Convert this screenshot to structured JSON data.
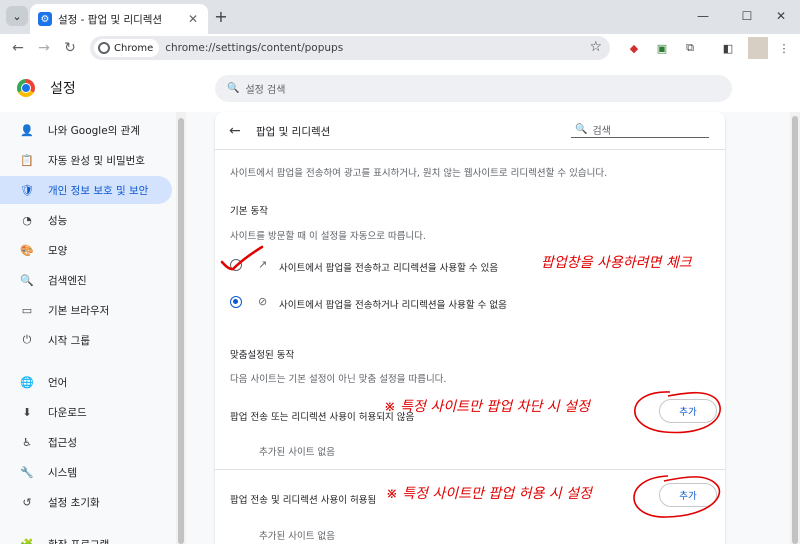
{
  "browser": {
    "tab_title": "설정 - 팝업 및 리디렉션",
    "tab_favicon": "⚙",
    "new_tab": "+",
    "menu_icon": "⌄",
    "close_tab": "✕",
    "chip_label": "Chrome",
    "url": "chrome://settings/content/popups",
    "win_min": "—",
    "win_max": "☐",
    "win_close": "✕"
  },
  "header": {
    "title": "설정",
    "search_placeholder": "설정 검색"
  },
  "sidebar": {
    "items": [
      {
        "label": "나와 Google의 관계",
        "icon": "👤"
      },
      {
        "label": "자동 완성 및 비밀번호",
        "icon": "📋"
      },
      {
        "label": "개인 정보 보호 및 보안",
        "icon": "🛡"
      },
      {
        "label": "성능",
        "icon": "◔"
      },
      {
        "label": "모양",
        "icon": "🎨"
      },
      {
        "label": "검색엔진",
        "icon": "🔍"
      },
      {
        "label": "기본 브라우저",
        "icon": "▭"
      },
      {
        "label": "시작 그룹",
        "icon": "⏻"
      },
      {
        "label": "언어",
        "icon": "🌐"
      },
      {
        "label": "다운로드",
        "icon": "⬇"
      },
      {
        "label": "접근성",
        "icon": "♿"
      },
      {
        "label": "시스템",
        "icon": "🔧"
      },
      {
        "label": "설정 초기화",
        "icon": "↺"
      },
      {
        "label": "확장 프로그램",
        "icon": "🧩"
      }
    ]
  },
  "page": {
    "title": "팝업 및 리디렉션",
    "search_placeholder": "검색",
    "description": "사이트에서 팝업을 전송하여 광고를 표시하거나, 원치 않는 웹사이트로 리디렉션할 수 있습니다.",
    "default_section_title": "기본 동작",
    "default_section_sub": "사이트를 방문할 때 이 설정을 자동으로 따릅니다.",
    "option_allow": "사이트에서 팝업을 전송하고 리디렉션을 사용할 수 있음",
    "option_block": "사이트에서 팝업을 전송하거나 리디렉션을 사용할 수 없음",
    "custom_section_title": "맞춤설정된 동작",
    "custom_section_sub": "다음 사이트는 기본 설정이 아닌 맞춤 설정을 따릅니다.",
    "not_allowed_title": "팝업 전송 또는 리디렉션 사용이 허용되지 않음",
    "not_allowed_empty": "추가된 사이트 없음",
    "allowed_title": "팝업 전송 및 리디렉션 사용이 허용됨",
    "allowed_empty": "추가된 사이트 없음",
    "add_label": "추가"
  },
  "annotations": {
    "note_checkbox": "팝업창을 사용하려면 체크",
    "note_block": "※ 특정 사이트만 팝업 차단 시 설정",
    "note_allow": "※ 특정 사이트만 팝업 허용 시 설정",
    "color": "#e00000"
  },
  "colors": {
    "accent": "#0b57d0",
    "active_bg": "#d3e3fd"
  }
}
